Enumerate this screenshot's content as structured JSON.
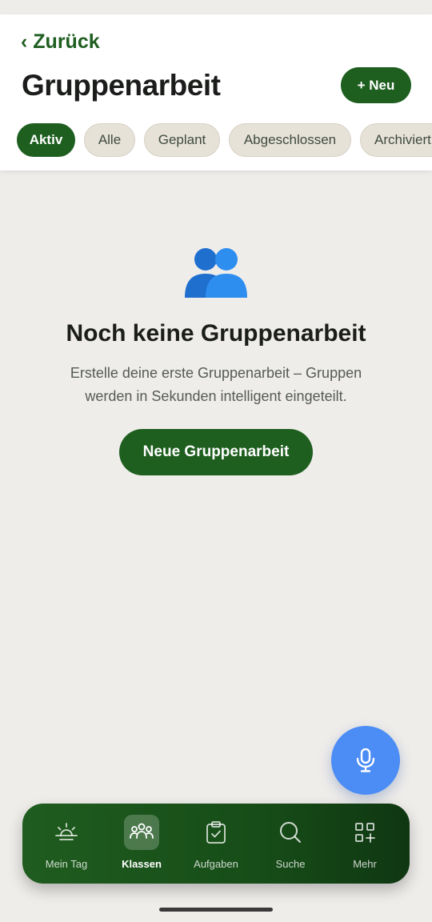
{
  "header": {
    "back_label": "‹ Zurück",
    "title": "Gruppenarbeit",
    "new_button_label": "+ Neu"
  },
  "tabs": [
    {
      "label": "Aktiv",
      "active": true
    },
    {
      "label": "Alle",
      "active": false
    },
    {
      "label": "Geplant",
      "active": false
    },
    {
      "label": "Abgeschlossen",
      "active": false
    },
    {
      "label": "Archiviert",
      "active": false
    }
  ],
  "empty_state": {
    "icon": "people-icon",
    "title": "Noch keine Gruppenarbeit",
    "description": "Erstelle deine erste Gruppenarbeit – Gruppen werden in Sekunden intelligent eingeteilt.",
    "cta_label": "Neue Gruppenarbeit"
  },
  "fab": {
    "icon": "microphone-icon"
  },
  "bottom_nav": [
    {
      "label": "Mein Tag",
      "icon": "sunrise-icon",
      "active": false
    },
    {
      "label": "Klassen",
      "icon": "group-icon",
      "active": true
    },
    {
      "label": "Aufgaben",
      "icon": "clipboard-check-icon",
      "active": false
    },
    {
      "label": "Suche",
      "icon": "search-icon",
      "active": false
    },
    {
      "label": "Mehr",
      "icon": "grid-plus-icon",
      "active": false
    }
  ],
  "colors": {
    "brand_green": "#1e5e1f",
    "background": "#efedea",
    "fab_blue": "#4b8cf5",
    "tab_inactive": "#e7e2d8"
  }
}
